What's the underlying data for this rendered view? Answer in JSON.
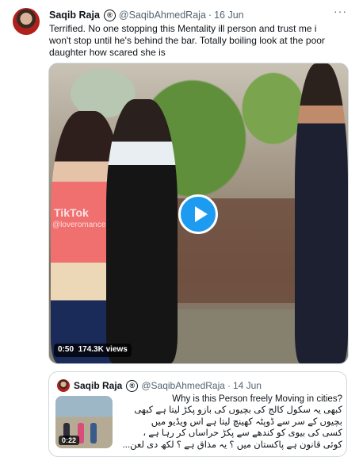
{
  "tweet": {
    "name": "Saqib Raja",
    "registered_mark": "®",
    "handle": "@SaqibAhmedRaja",
    "separator": "·",
    "date": "16 Jun",
    "more_icon": "more-icon",
    "text": "Terrified. No one stopping this Mentality ill person and trust me i won't stop until he's behind the bar. Totally boiling look at the poor daughter how scared she is"
  },
  "video": {
    "watermark": "TikTok",
    "watermark_handle": "@loveromance",
    "time": "0:50",
    "views": "174.3K views",
    "play_icon": "play-icon"
  },
  "quoted": {
    "name": "Saqib Raja",
    "registered_mark": "®",
    "handle": "@SaqibAhmedRaja",
    "separator": "·",
    "date": "14 Jun",
    "duration": "0:22",
    "lines": [
      "?Why is this Person freely Moving in cities",
      "کبھی یہ سکول کالج کی بچیوں کی بازو پکڑ لیتا ہے کبھی",
      "بچیوں کے سر سے ڈوپٹہ کھینچ لیتا ہے اس ویڈیو میں",
      "کسی کی بیوی کو کندھے سے پکڑ حراساں کر رہا ہے ،",
      "کوئی قانون ہے پاکستان میں ؟ یہ مذاق ہے ؟ لکھ دی لعن..."
    ]
  }
}
